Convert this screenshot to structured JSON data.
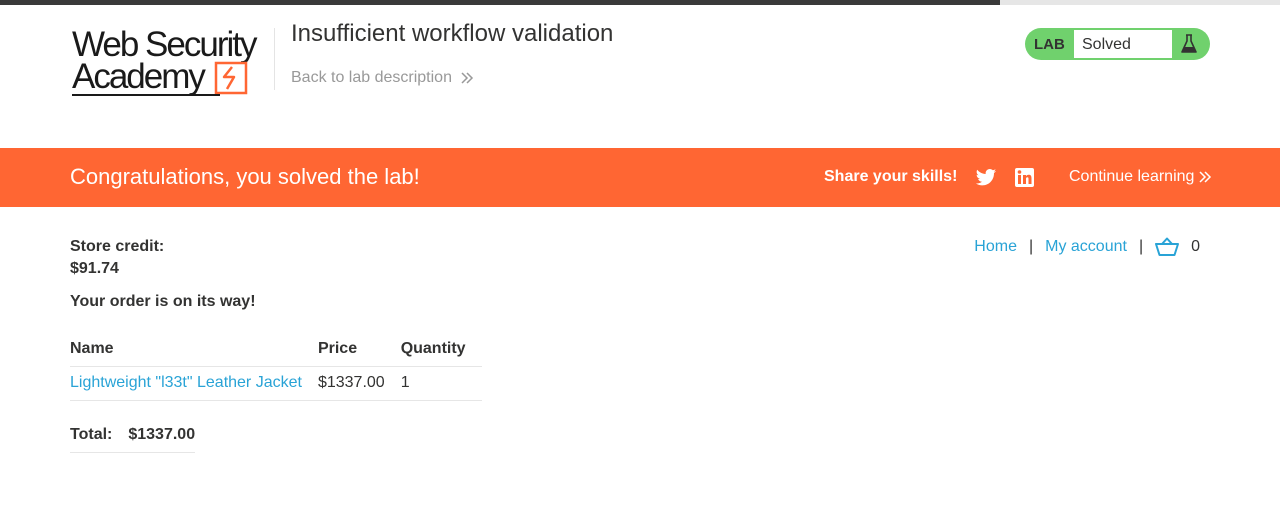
{
  "header": {
    "logo_line1": "Web Security",
    "logo_line2": "Academy",
    "lab_title": "Insufficient workflow validation",
    "back_link": "Back to lab description",
    "lab_status": {
      "tag": "LAB",
      "state": "Solved"
    }
  },
  "banner": {
    "message": "Congratulations, you solved the lab!",
    "share": "Share your skills!",
    "continue": "Continue learning",
    "icons": [
      "twitter-icon",
      "linkedin-icon"
    ]
  },
  "nav": {
    "home": "Home",
    "my_account": "My account",
    "separator": "|",
    "cart_count": "0"
  },
  "account": {
    "credit_label": "Store credit:",
    "credit_value": "$91.74",
    "order_message": "Your order is on its way!"
  },
  "order_table": {
    "headers": [
      "Name",
      "Price",
      "Quantity"
    ],
    "rows": [
      {
        "name": "Lightweight \"l33t\" Leather Jacket",
        "price": "$1337.00",
        "quantity": "1"
      }
    ]
  },
  "total": {
    "label": "Total:",
    "value": "$1337.00"
  },
  "colors": {
    "accent_orange": "#ff6633",
    "solved_green": "#70d16d",
    "link_blue": "#29a3d6",
    "text_dark": "#333332"
  }
}
